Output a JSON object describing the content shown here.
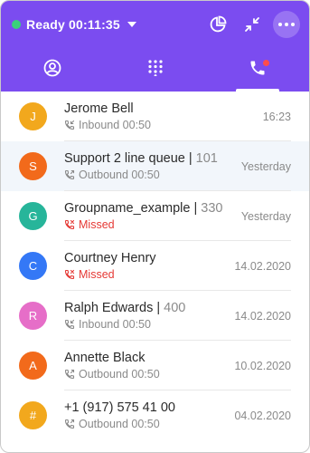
{
  "header": {
    "status_label": "Ready",
    "timer": "00:11:35",
    "status_color": "#39d27b",
    "brand_color": "#7b4cf0",
    "actions": [
      {
        "icon": "pie-chart-icon"
      },
      {
        "icon": "collapse-icon"
      },
      {
        "icon": "more-icon"
      }
    ]
  },
  "tabs": [
    {
      "icon": "user-icon",
      "active": false
    },
    {
      "icon": "dialpad-icon",
      "active": false
    },
    {
      "icon": "phone-icon",
      "active": true,
      "has_notification": true
    }
  ],
  "calls": [
    {
      "initial": "J",
      "color": "#f2a81d",
      "name": "Jerome Bell",
      "ext": "",
      "direction": "Inbound",
      "duration": "00:50",
      "time": "16:23",
      "type": "normal"
    },
    {
      "initial": "S",
      "color": "#f26a1b",
      "name": "Support 2 line queue",
      "ext": "101",
      "direction": "Outbound",
      "duration": "00:50",
      "time": "Yesterday",
      "type": "normal"
    },
    {
      "initial": "G",
      "color": "#27b59a",
      "name": "Groupname_example",
      "ext": "330",
      "direction": "Missed",
      "duration": "",
      "time": "Yesterday",
      "type": "missed"
    },
    {
      "initial": "C",
      "color": "#3478f6",
      "name": "Courtney Henry",
      "ext": "",
      "direction": "Missed",
      "duration": "",
      "time": "14.02.2020",
      "type": "missed"
    },
    {
      "initial": "R",
      "color": "#e66ec8",
      "name": "Ralph Edwards",
      "ext": "400",
      "direction": "Inbound",
      "duration": "00:50",
      "time": "14.02.2020",
      "type": "normal"
    },
    {
      "initial": "A",
      "color": "#f26a1b",
      "name": "Annette Black",
      "ext": "",
      "direction": "Outbound",
      "duration": "00:50",
      "time": "10.02.2020",
      "type": "normal"
    },
    {
      "initial": "#",
      "color": "#f2a81d",
      "name": "+1 (917) 575 41 00",
      "ext": "",
      "direction": "Outbound",
      "duration": "00:50",
      "time": "04.02.2020",
      "type": "normal"
    }
  ]
}
